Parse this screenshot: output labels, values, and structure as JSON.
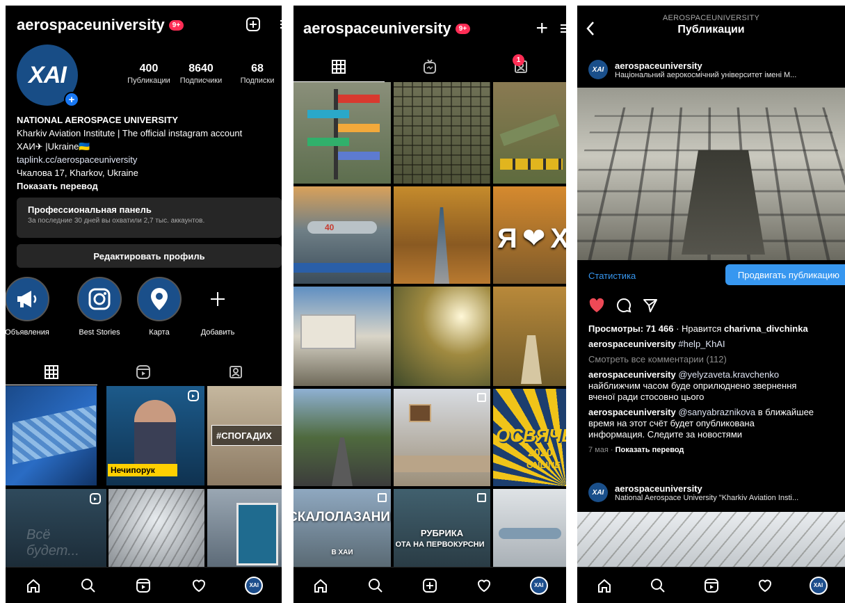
{
  "screen1": {
    "username": "aerospaceuniversity",
    "notif_badge": "9+",
    "avatar_text": "XAI",
    "stats": [
      {
        "value": "400",
        "label": "Публикации"
      },
      {
        "value": "8640",
        "label": "Подписчики"
      },
      {
        "value": "68",
        "label": "Подписки"
      }
    ],
    "bio": {
      "name": "NATIONAL AEROSPACE UNIVERSITY",
      "line1": "Kharkiv Aviation Institute | The official instagram account",
      "line2": "ХАИ✈ |Ukraine🇺🇦",
      "link": "taplink.cc/aerospaceuniversity",
      "address": "Чкалова 17, Kharkov, Ukraine",
      "translate": "Показать перевод"
    },
    "pro_panel": {
      "title": "Профессиональная панель",
      "subtitle": "За последние 30 дней вы охватили 2,7 тыс. аккаунтов."
    },
    "edit_profile": "Редактировать профиль",
    "highlights": [
      {
        "label": "Объявления",
        "icon": "megaphone-icon"
      },
      {
        "label": "Best Stories",
        "icon": "instagram-icon"
      },
      {
        "label": "Карта",
        "icon": "map-pin-icon"
      },
      {
        "label": "Добавить",
        "icon": "plus-icon"
      }
    ],
    "tiles": {
      "nechiporuk_label": "Нечипорук",
      "spogadi_label": "#СПОГАДИХ",
      "ghost_text": "Всё будет..."
    }
  },
  "screen2": {
    "username": "aerospaceuniversity",
    "notif_badge": "9+",
    "tagged_badge": "1",
    "tiles": {
      "skalo": "СКАЛОЛАЗАНИЕ",
      "skalo_sub": "В ХАИ",
      "rubrika_title": "РУБРИКА",
      "rubrika_sub": "ОТА НА ПЕРВОКУРСНИ",
      "osvyach": "ОСВЯЧЕ",
      "osvyach_year": "2020",
      "osvyach_sub": "ONLINE",
      "ya_heart": "Я ❤ Х",
      "plane_number": "40"
    }
  },
  "screen3": {
    "header_sub": "AEROSPACEUNIVERSITY",
    "header_title": "Публикации",
    "post1": {
      "username": "aerospaceuniversity",
      "desc": "Національний аерокосмічний університет імені М..."
    },
    "stats_link": "Статистика",
    "promote_button": "Продвигать публикацию",
    "views_label": "Просмотры: 71 466",
    "likes_prefix": " · Нравится ",
    "likes_user": "charivna_divchinka",
    "caption_user": "aerospaceuniversity",
    "caption_tag": "#help_KhAI",
    "view_comments": "Смотреть все комментарии (112)",
    "comment1": {
      "user": "aerospaceuniversity",
      "mention": "@yelyzaveta.kravchenko",
      "text1": "найближчим часом буде оприлюднено звернення",
      "text2": "вченої ради стосовно цього"
    },
    "comment2": {
      "user": "aerospaceuniversity",
      "mention": "@sanyabraznikova",
      "text0": " в ближайшее",
      "text1": "время на этот счёт будет опубликована",
      "text2": "информация. Следите за новостями"
    },
    "date": "7 мая",
    "translate": "Показать перевод",
    "post2": {
      "username": "aerospaceuniversity",
      "desc": "National Aerospace University \"Kharkiv Aviation Insti..."
    }
  }
}
